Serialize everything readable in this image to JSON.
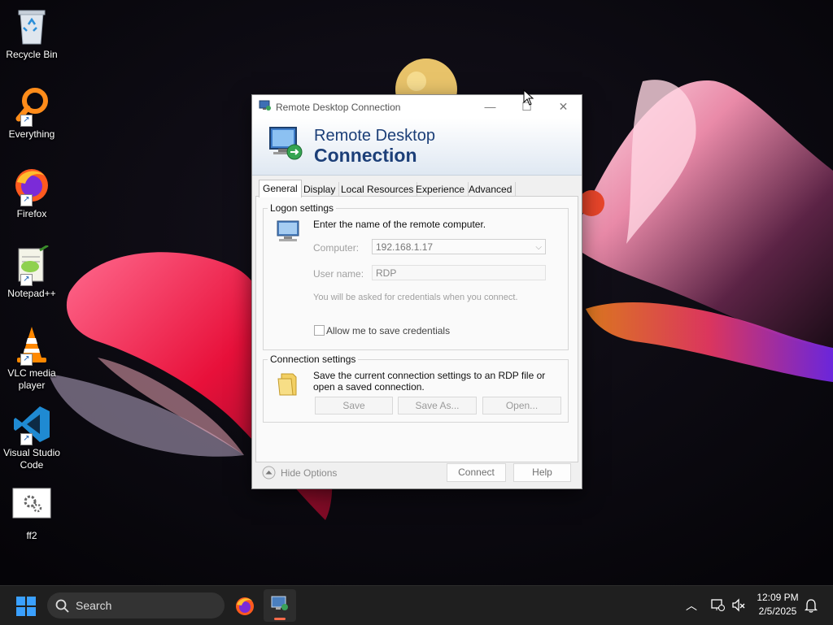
{
  "desktop": {
    "icons": [
      {
        "label": "Recycle Bin",
        "icon": "recycle-bin-icon"
      },
      {
        "label": "Everything",
        "icon": "magnifier-icon"
      },
      {
        "label": "Firefox",
        "icon": "firefox-icon"
      },
      {
        "label": "Notepad++",
        "icon": "notepad-plus-plus-icon"
      },
      {
        "label": "VLC media player",
        "icon": "vlc-cone-icon"
      },
      {
        "label": "Visual Studio Code",
        "icon": "vscode-icon"
      },
      {
        "label": "ff2",
        "icon": "settings-file-icon"
      }
    ]
  },
  "window": {
    "title": "Remote Desktop Connection",
    "banner_line1": "Remote Desktop",
    "banner_line2": "Connection",
    "tabs": [
      {
        "label": "General",
        "active": true
      },
      {
        "label": "Display"
      },
      {
        "label": "Local Resources"
      },
      {
        "label": "Experience"
      },
      {
        "label": "Advanced"
      }
    ],
    "logon": {
      "title": "Logon settings",
      "instruction": "Enter the name of the remote computer.",
      "computer_label": "Computer:",
      "computer_value": "192.168.1.17",
      "username_label": "User name:",
      "username_value": "RDP",
      "credentials_note": "You will be asked for credentials when you connect.",
      "save_credentials_label": "Allow me to save credentials",
      "save_credentials_checked": false
    },
    "connection": {
      "title": "Connection settings",
      "description": "Save the current connection settings to an RDP file or open a saved connection.",
      "save_label": "Save",
      "save_as_label": "Save As...",
      "open_label": "Open..."
    },
    "footer": {
      "hide_options_label": "Hide Options",
      "connect_label": "Connect",
      "help_label": "Help"
    }
  },
  "taskbar": {
    "search_placeholder": "Search",
    "time": "12:09 PM",
    "date": "2/5/2025"
  },
  "colors": {
    "banner_text": "#1c3f78",
    "taskbar_bg": "#1f1f1f",
    "windows_blue": "#3aa0ff"
  }
}
